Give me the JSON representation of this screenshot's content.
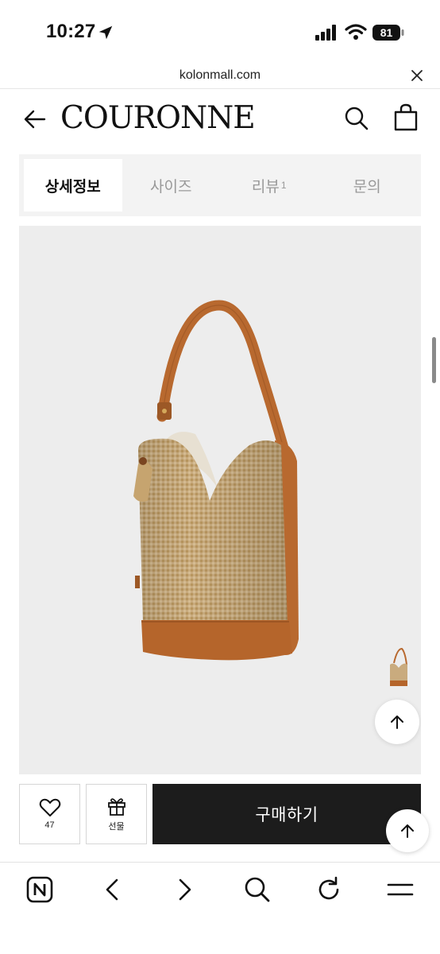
{
  "status_bar": {
    "time": "10:27",
    "battery": "81"
  },
  "url_bar": {
    "url": "kolonmall.com"
  },
  "header": {
    "brand": "COURONNE"
  },
  "tabs": [
    {
      "label": "상세정보",
      "active": true
    },
    {
      "label": "사이즈",
      "active": false
    },
    {
      "label": "리뷰",
      "count": "1",
      "active": false
    },
    {
      "label": "문의",
      "active": false
    }
  ],
  "product": {
    "image_bg": "#ededed"
  },
  "action_bar": {
    "like_count": "47",
    "gift_label": "선물",
    "buy_label": "구매하기"
  },
  "colors": {
    "buy_bg": "#1c1c1c",
    "tab_bg": "#f3f3f3",
    "tan": "#b8692f",
    "raffia": "#c9ab7e"
  },
  "icons": [
    "location-arrow-icon",
    "signal-icon",
    "wifi-icon",
    "battery-icon",
    "close-icon",
    "back-arrow-icon",
    "search-icon",
    "shopping-bag-icon",
    "heart-icon",
    "gift-icon",
    "arrow-up-icon",
    "naver-icon",
    "chevron-left-icon",
    "chevron-right-icon",
    "refresh-icon",
    "menu-icon"
  ]
}
